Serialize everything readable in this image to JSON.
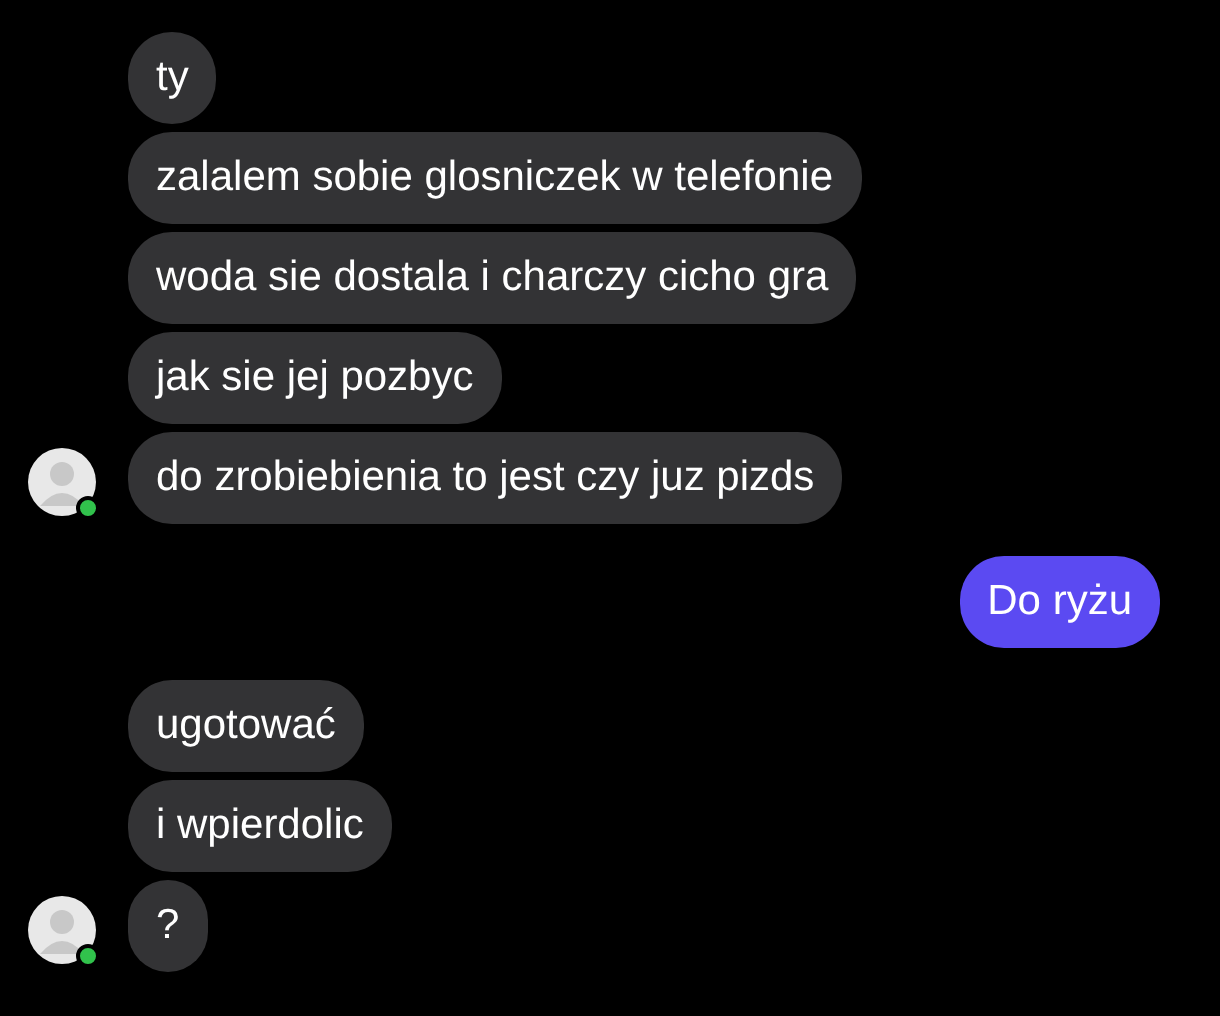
{
  "messages_groups": [
    {
      "kind": "received",
      "online": true,
      "messages": [
        "ty",
        "zalalem sobie glosniczek w telefonie",
        "woda sie dostala i charczy cicho gra",
        "jak sie jej pozbyc",
        "do zrobiebienia to jest czy juz pizds"
      ]
    },
    {
      "kind": "sent",
      "messages": [
        "Do ryżu"
      ]
    },
    {
      "kind": "received",
      "online": true,
      "messages": [
        "ugotować",
        "i wpierdolic",
        "?"
      ]
    }
  ]
}
